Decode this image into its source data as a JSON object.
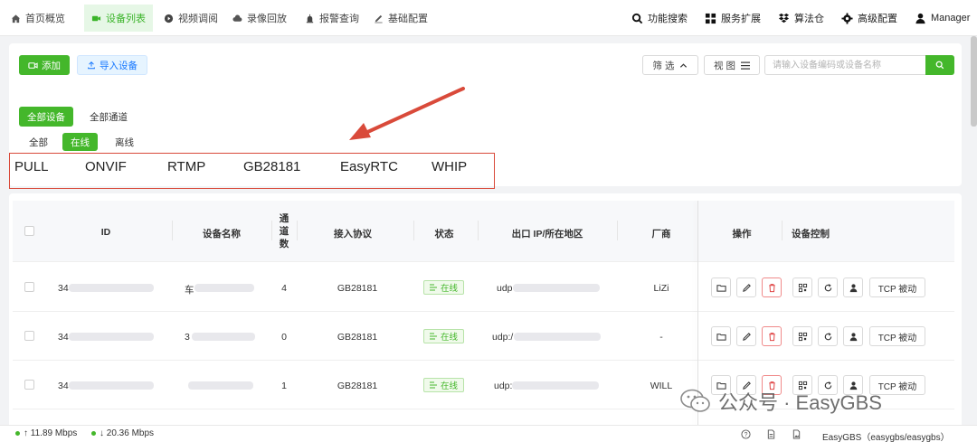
{
  "nav": {
    "items": [
      {
        "label": "首页概览",
        "icon": "home-icon"
      },
      {
        "label": "设备列表",
        "icon": "camera-icon",
        "active": true
      },
      {
        "label": "视频调阅",
        "icon": "play-icon"
      },
      {
        "label": "录像回放",
        "icon": "cloud-icon"
      },
      {
        "label": "报警查询",
        "icon": "alarm-icon"
      },
      {
        "label": "基础配置",
        "icon": "edit-icon"
      }
    ],
    "right": [
      {
        "label": "功能搜索",
        "icon": "search-icon"
      },
      {
        "label": "服务扩展",
        "icon": "grid-icon"
      },
      {
        "label": "算法仓",
        "icon": "dropbox-icon"
      },
      {
        "label": "高级配置",
        "icon": "gear-icon"
      },
      {
        "label": "Manager",
        "icon": "user-icon"
      }
    ]
  },
  "toolbar": {
    "add_label": "添加",
    "import_label": "导入设备",
    "filter_label": "筛 选",
    "view_label": "视 图",
    "search_placeholder": "请输入设备编码或设备名称"
  },
  "filters": {
    "device_tabs": [
      "全部设备",
      "全部通道"
    ],
    "status_tabs": [
      "全部",
      "在线",
      "离线"
    ],
    "protocols": [
      "PULL",
      "ONVIF",
      "RTMP",
      "GB28181",
      "EasyRTC",
      "WHIP"
    ]
  },
  "table": {
    "headers": {
      "id": "ID",
      "name": "设备名称",
      "channels": [
        "通",
        "道",
        "数"
      ],
      "protocol": "接入协议",
      "status": "状态",
      "ip": "出口 IP/所在地区",
      "vendor": "厂商",
      "ops": "操作",
      "control": "设备控制"
    },
    "rows": [
      {
        "id_prefix": "34",
        "name_prefix": "车",
        "channels": "4",
        "protocol": "GB28181",
        "status": "在线",
        "ip_prefix": "udp",
        "vendor": "LiZi"
      },
      {
        "id_prefix": "34",
        "name_prefix": "3",
        "channels": "0",
        "protocol": "GB28181",
        "status": "在线",
        "ip_prefix": "udp:/",
        "vendor": "-"
      },
      {
        "id_prefix": "34",
        "name_prefix": "",
        "channels": "1",
        "protocol": "GB28181",
        "status": "在线",
        "ip_prefix": "udp:",
        "vendor": "WILL"
      }
    ],
    "tcp_label": "TCP 被动"
  },
  "statusbar": {
    "upload": "↑ 11.89 Mbps",
    "download": "↓ 20.36 Mbps",
    "version": "EasyGBS（easygbs/easygbs）"
  },
  "watermark": "公众号 · EasyGBS",
  "colors": {
    "accent": "#44b72b",
    "annotation": "#d94a3a"
  }
}
